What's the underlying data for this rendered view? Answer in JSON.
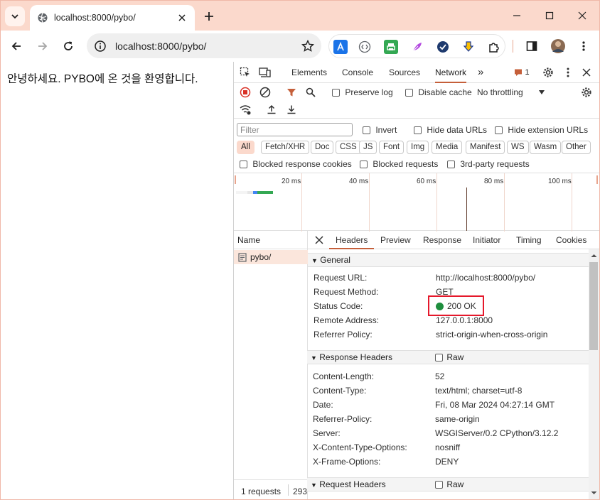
{
  "browser": {
    "tab_title": "localhost:8000/pybo/",
    "url": "localhost:8000/pybo/"
  },
  "page": {
    "text": "안녕하세요. PYBO에 온 것을 환영합니다."
  },
  "devtools": {
    "tabs": [
      "Elements",
      "Console",
      "Sources",
      "Network"
    ],
    "active_tab": "Network",
    "more": "»",
    "issues_count": "1",
    "toolbar": {
      "preserve_log": "Preserve log",
      "disable_cache": "Disable cache",
      "throttling": "No throttling"
    },
    "filter_placeholder": "Filter",
    "invert": "Invert",
    "hide_data_urls": "Hide data URLs",
    "hide_extension_urls": "Hide extension URLs",
    "type_chips": [
      "All",
      "Fetch/XHR",
      "Doc",
      "CSS",
      "JS",
      "Font",
      "Img",
      "Media",
      "Manifest",
      "WS",
      "Wasm",
      "Other"
    ],
    "blocked_response_cookies": "Blocked response cookies",
    "blocked_requests": "Blocked requests",
    "third_party": "3rd-party requests",
    "timeline_ticks": [
      "20 ms",
      "40 ms",
      "60 ms",
      "80 ms",
      "100 ms"
    ],
    "name_header": "Name",
    "request_name": "pybo/",
    "footer_requests": "1 requests",
    "footer_size": "293",
    "detail_tabs": [
      "Headers",
      "Preview",
      "Response",
      "Initiator",
      "Timing",
      "Cookies"
    ],
    "general": {
      "title": "General",
      "rows": [
        {
          "key": "Request URL:",
          "value": "http://localhost:8000/pybo/"
        },
        {
          "key": "Request Method:",
          "value": "GET"
        },
        {
          "key": "Status Code:",
          "value": "200 OK"
        },
        {
          "key": "Remote Address:",
          "value": "127.0.0.1:8000"
        },
        {
          "key": "Referrer Policy:",
          "value": "strict-origin-when-cross-origin"
        }
      ]
    },
    "response_headers": {
      "title": "Response Headers",
      "raw": "Raw",
      "rows": [
        {
          "key": "Content-Length:",
          "value": "52"
        },
        {
          "key": "Content-Type:",
          "value": "text/html; charset=utf-8"
        },
        {
          "key": "Date:",
          "value": "Fri, 08 Mar 2024 04:27:14 GMT"
        },
        {
          "key": "Referrer-Policy:",
          "value": "same-origin"
        },
        {
          "key": "Server:",
          "value": "WSGIServer/0.2 CPython/3.12.2"
        },
        {
          "key": "X-Content-Type-Options:",
          "value": "nosniff"
        },
        {
          "key": "X-Frame-Options:",
          "value": "DENY"
        }
      ]
    },
    "request_headers": {
      "title": "Request Headers",
      "raw": "Raw"
    }
  },
  "colors": {
    "accent": "#c55f3a",
    "tabstrip": "#fbd9cc",
    "status_ok": "#1e8e3e",
    "highlight": "#e5182b"
  }
}
